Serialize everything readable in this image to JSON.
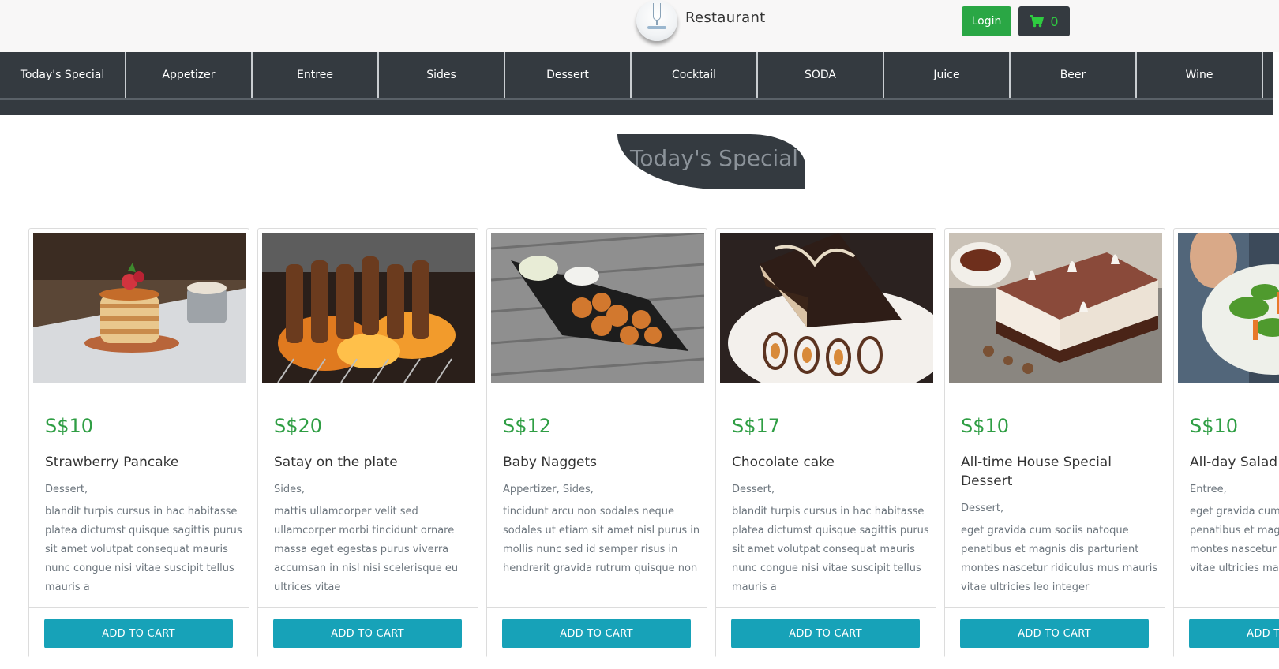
{
  "header": {
    "brand": "Restaurant",
    "login_label": "Login",
    "cart_count": "0"
  },
  "nav": {
    "items": [
      "Today's Special",
      "Appetizer",
      "Entree",
      "Sides",
      "Dessert",
      "Cocktail",
      "SODA",
      "Juice",
      "Beer",
      "Wine"
    ]
  },
  "section": {
    "title": "Today's Special"
  },
  "cards": [
    {
      "price": "S$10",
      "title": "Strawberry Pancake",
      "category": "Dessert,",
      "description": "blandit turpis cursus in hac habitasse platea dictumst quisque sagittis purus sit amet volutpat consequat mauris nunc congue nisi vitae suscipit tellus mauris a",
      "button": "ADD TO CART",
      "image": "pancake-photo"
    },
    {
      "price": "S$20",
      "title": "Satay on the plate",
      "category": "Sides,",
      "description": "mattis ullamcorper velit sed ullamcorper morbi tincidunt ornare massa eget egestas purus viverra accumsan in nisl nisi scelerisque eu ultrices vitae",
      "button": "ADD TO CART",
      "image": "satay-grill-photo"
    },
    {
      "price": "S$12",
      "title": "Baby Naggets",
      "category": "Appertizer, Sides,",
      "description": "tincidunt arcu non sodales neque sodales ut etiam sit amet nisl purus in mollis nunc sed id semper risus in hendrerit gravida rutrum quisque non",
      "button": "ADD TO CART",
      "image": "nuggets-photo"
    },
    {
      "price": "S$17",
      "title": "Chocolate cake",
      "category": "Dessert,",
      "description": "blandit turpis cursus in hac habitasse platea dictumst quisque sagittis purus sit amet volutpat consequat mauris nunc congue nisi vitae suscipit tellus mauris a",
      "button": "ADD TO CART",
      "image": "chocolate-cake-photo"
    },
    {
      "price": "S$10",
      "title": "All-time House Special Dessert",
      "category": "Dessert,",
      "description": "eget gravida cum sociis natoque penatibus et magnis dis parturient montes nascetur ridiculus mus mauris vitae ultricies leo integer",
      "button": "ADD TO CART",
      "image": "layer-cake-photo"
    },
    {
      "price": "S$10",
      "title": "All-day Salad",
      "category": "Entree,",
      "description": "eget gravida cum sociis natoque penatibus et magnis dis parturient montes nascetur ridiculus mus mauris vitae ultricies malesuada nunc",
      "button": "ADD TO CART",
      "image": "salad-photo"
    }
  ],
  "colors": {
    "nav_bg": "#343a40",
    "login_green": "#2aa745",
    "price_green": "#2f9e44",
    "button_teal": "#17a2b8"
  }
}
